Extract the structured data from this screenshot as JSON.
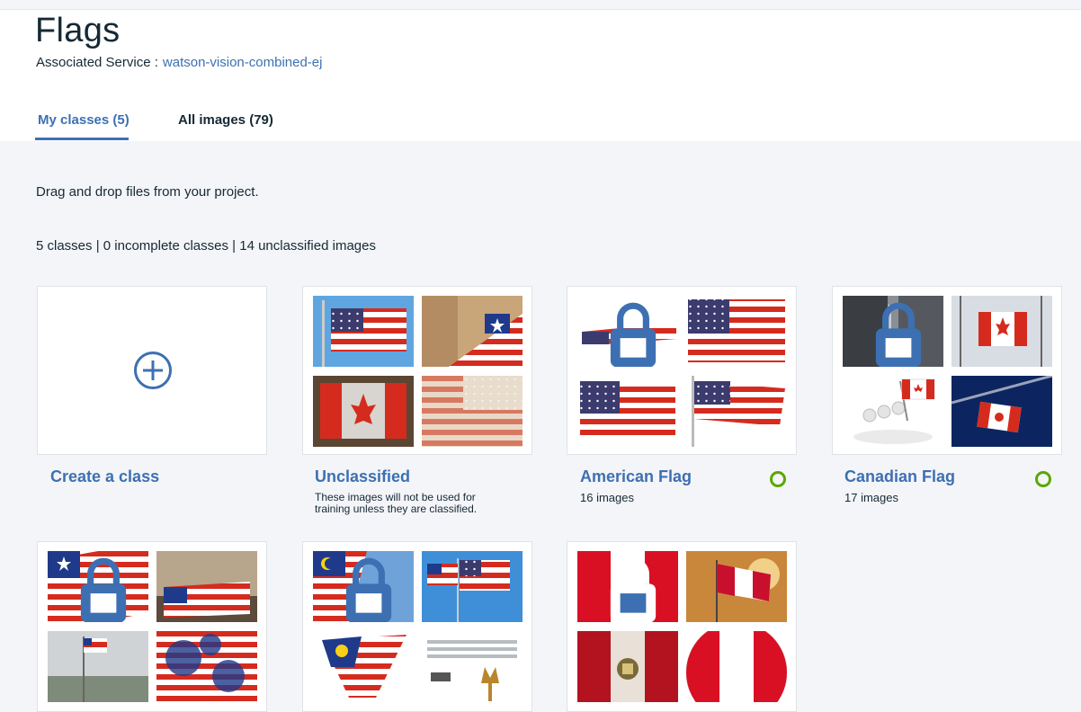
{
  "header": {
    "title": "Flags",
    "service_label": "Associated Service :",
    "service_name": "watson-vision-combined-ej"
  },
  "tabs": [
    {
      "label": "My classes (5)",
      "active": true
    },
    {
      "label": "All images (79)",
      "active": false
    }
  ],
  "hint": "Drag and drop files from your project.",
  "summary": "5 classes | 0 incomplete classes | 14 unclassified images",
  "create_class": {
    "label": "Create a class",
    "icon": "plus-circle-icon"
  },
  "classes": [
    {
      "name": "Unclassified",
      "note": "These images will not be used for training unless they are classified."
    },
    {
      "name": "American Flag",
      "count": "16 images",
      "status": "complete"
    },
    {
      "name": "Canadian Flag",
      "count": "17 images",
      "status": "complete"
    }
  ],
  "colors": {
    "accent": "#3d70b2",
    "status_ok": "#5aa700",
    "flag_red": "#d52b1e",
    "flag_blue": "#3c3b6e"
  }
}
